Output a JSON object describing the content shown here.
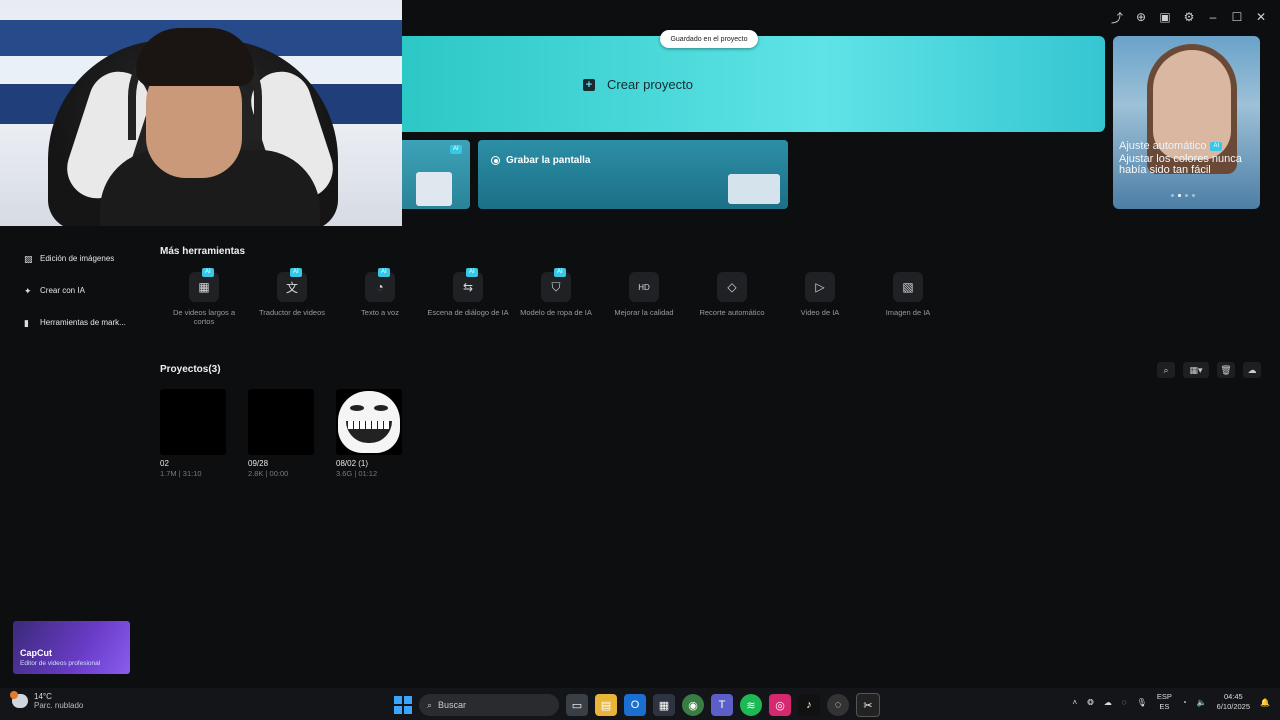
{
  "hero": {
    "create_label": "Crear proyecto",
    "saved_label": "Guardado en el proyecto"
  },
  "side_card": {
    "title": "Ajuste automático",
    "ai": "AI",
    "subtitle": "Ajustar los colores nunca había sido tan fácil"
  },
  "cards": {
    "ai": "AI",
    "record_label": "Grabar la pantalla"
  },
  "sidebar": {
    "items": [
      {
        "label": "Edición de imágenes",
        "icon": "image-icon"
      },
      {
        "label": "Crear con IA",
        "icon": "sparkle-icon"
      },
      {
        "label": "Herramientas de mark...",
        "icon": "marketing-icon"
      }
    ]
  },
  "tools": {
    "title": "Más herramientas",
    "items": [
      {
        "label": "De videos largos a cortos",
        "icon": "film-icon",
        "ai": "AI"
      },
      {
        "label": "Traductor de videos",
        "icon": "translate-icon",
        "ai": "AI"
      },
      {
        "label": "Texto a voz",
        "icon": "voice-icon",
        "ai": "AI"
      },
      {
        "label": "Escena de diálogo de IA",
        "icon": "dialog-icon",
        "ai": "AI"
      },
      {
        "label": "Modelo de ropa de IA",
        "icon": "shirt-icon",
        "ai": "AI"
      },
      {
        "label": "Mejorar la calidad",
        "icon": "hd-icon",
        "ai": ""
      },
      {
        "label": "Recorte automático",
        "icon": "eraser-icon",
        "ai": ""
      },
      {
        "label": "Video de IA",
        "icon": "video-ai-icon",
        "ai": ""
      },
      {
        "label": "Imagen de IA",
        "icon": "image-ai-icon",
        "ai": ""
      }
    ]
  },
  "projects": {
    "title": "Proyectos(3)",
    "items": [
      {
        "name": "02",
        "meta": "1.7M | 31:10"
      },
      {
        "name": "09/28",
        "meta": "2.8K | 00:00"
      },
      {
        "name": "08/02 (1)",
        "meta": "3.6G | 01:12"
      }
    ]
  },
  "capcut": {
    "title": "CapCut",
    "subtitle": "Editor de videos profesional"
  },
  "taskbar": {
    "temp": "14°C",
    "weather": "Parc. nublado",
    "search_placeholder": "Buscar",
    "lang1": "ESP",
    "lang2": "ES",
    "time": "04:45",
    "date": "6/10/2025"
  },
  "colors": {
    "accent": "#37c8e6",
    "hero": "#5fe3e6",
    "background": "#0d0e10"
  }
}
